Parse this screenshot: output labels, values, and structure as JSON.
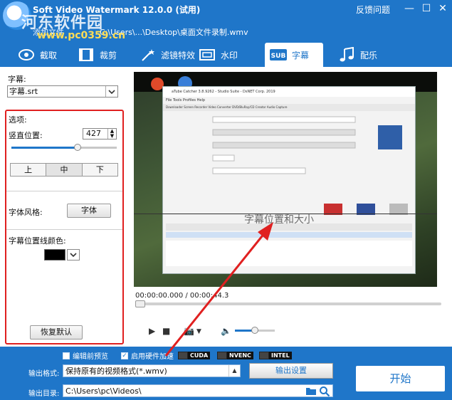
{
  "titlebar": {
    "title": "Soft Video Watermark 12.0.0 (试用)",
    "overlay_site": "河东软件园",
    "overlay_url": "www.pc0359.cn",
    "add_file": "添加文件",
    "file_path": "C:\\Users\\...\\Desktop\\桌面文件录制.wmv",
    "feedback": "反馈问题",
    "minimize": "—",
    "maximize": "☐",
    "close": "✕"
  },
  "tabs": [
    {
      "label": "截取",
      "icon": "crop-icon"
    },
    {
      "label": "裁剪",
      "icon": "film-icon"
    },
    {
      "label": "滤镜特效",
      "icon": "magic-wand-icon"
    },
    {
      "label": "水印",
      "icon": "watermark-frame-icon"
    },
    {
      "label": "字幕",
      "icon": "subtitle-icon"
    },
    {
      "label": "配乐",
      "icon": "music-icon"
    }
  ],
  "active_tab": "字幕",
  "left_panel": {
    "subtitle_label": "字幕:",
    "subtitle_file": "字幕.srt",
    "options_label": "选项:",
    "vertical_pos_label": "竖直位置:",
    "vertical_pos_value": "427",
    "vertical_slider_fraction": 0.63,
    "align_buttons": [
      "上",
      "中",
      "下"
    ],
    "align_selected": "中",
    "font_style_label": "字体风格:",
    "font_button": "字体",
    "outline_color_label": "字幕位置线颜色:",
    "outline_color": "#000000",
    "reset_button": "恢复默认"
  },
  "preview": {
    "inner_window_title": "aTube Catcher 3.8.9262 - Studio Suite - DsNET Corp. 2019",
    "inner_menu": "File   Tools   Profiles   Help",
    "inner_tabs": "Downloader   Screen Recorder   Video Converter   DVD/BluRay/CD Creator   Audio Capture",
    "subtitle_preview_text": "字幕位置和大小",
    "time_current": "00:00:00.000",
    "time_separator": " / ",
    "time_total": "00:00:44.3",
    "volume_fraction": 0.5,
    "play_icon": "▶",
    "stop_icon": "■",
    "camera_icon": "📷",
    "camera_dropdown": "▼",
    "volume_icon": "🔈"
  },
  "bottom": {
    "option1": "编辑前预览",
    "option1_checked": false,
    "option2": "启用硬件加速",
    "option2_checked": true,
    "accel": [
      "CUDA",
      "NVENC",
      "INTEL"
    ],
    "output_format_label": "输出格式:",
    "output_format": "保持原有的视频格式(*.wmv)",
    "output_settings": "输出设置",
    "output_dir_label": "输出目录:",
    "output_dir": "C:\\Users\\pc\\Videos\\",
    "start": "开始"
  },
  "colors": {
    "brand": "#1f76c9",
    "highlight_box": "#e02020",
    "annotation_arrow": "#e02020"
  }
}
